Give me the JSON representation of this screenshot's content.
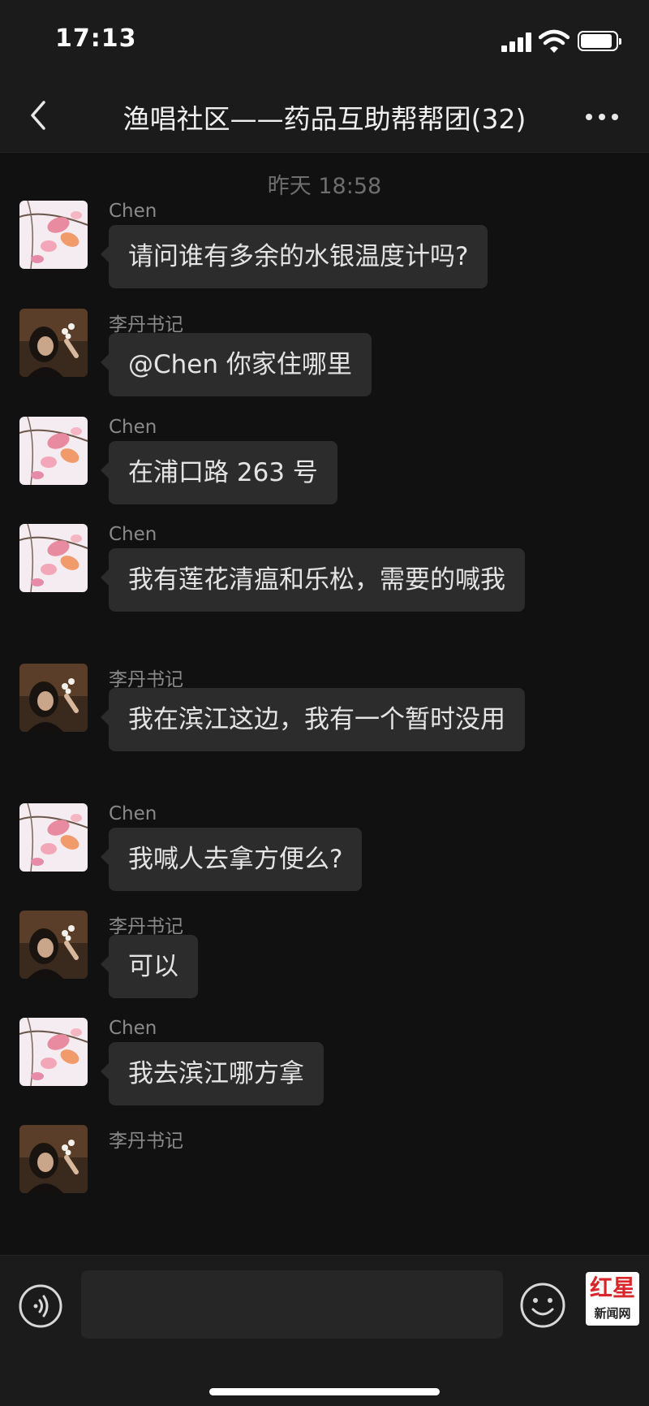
{
  "status_bar": {
    "time": "17:13",
    "icons": [
      "cellular-signal-icon",
      "wifi-icon",
      "battery-icon"
    ],
    "battery_level": 0.9
  },
  "nav": {
    "back_icon": "chevron-left-icon",
    "title": "渔唱社区——药品互助帮帮团(32)",
    "more_icon": "ellipsis-icon"
  },
  "chat": {
    "timestamp": "昨天 18:58",
    "messages": [
      {
        "sender": "Chen",
        "text": "请问谁有多余的水银温度计吗?"
      },
      {
        "sender": "李丹书记",
        "text": "@Chen 你家住哪里"
      },
      {
        "sender": "Chen",
        "text": "在浦口路 263 号"
      },
      {
        "sender": "Chen",
        "text": "我有莲花清瘟和乐松，需要的喊我"
      },
      {
        "sender": "李丹书记",
        "text": "我在滨江这边，我有一个暂时没用"
      },
      {
        "sender": "Chen",
        "text": "我喊人去拿方便么?"
      },
      {
        "sender": "李丹书记",
        "text": "可以"
      },
      {
        "sender": "Chen",
        "text": "我去滨江哪方拿"
      },
      {
        "sender": "李丹书记",
        "text": ""
      }
    ]
  },
  "input_bar": {
    "voice_icon": "voice-input-icon",
    "input_value": "",
    "emoji_icon": "emoji-icon",
    "watermark_top": "红星",
    "watermark_bottom": "新闻网"
  },
  "colors": {
    "background": "#111111",
    "bar_background": "#1b1b1b",
    "bubble": "#2c2c2c",
    "text": "#e4e4e4",
    "sender": "#8a8a8a",
    "watermark_red": "#d8262b"
  }
}
